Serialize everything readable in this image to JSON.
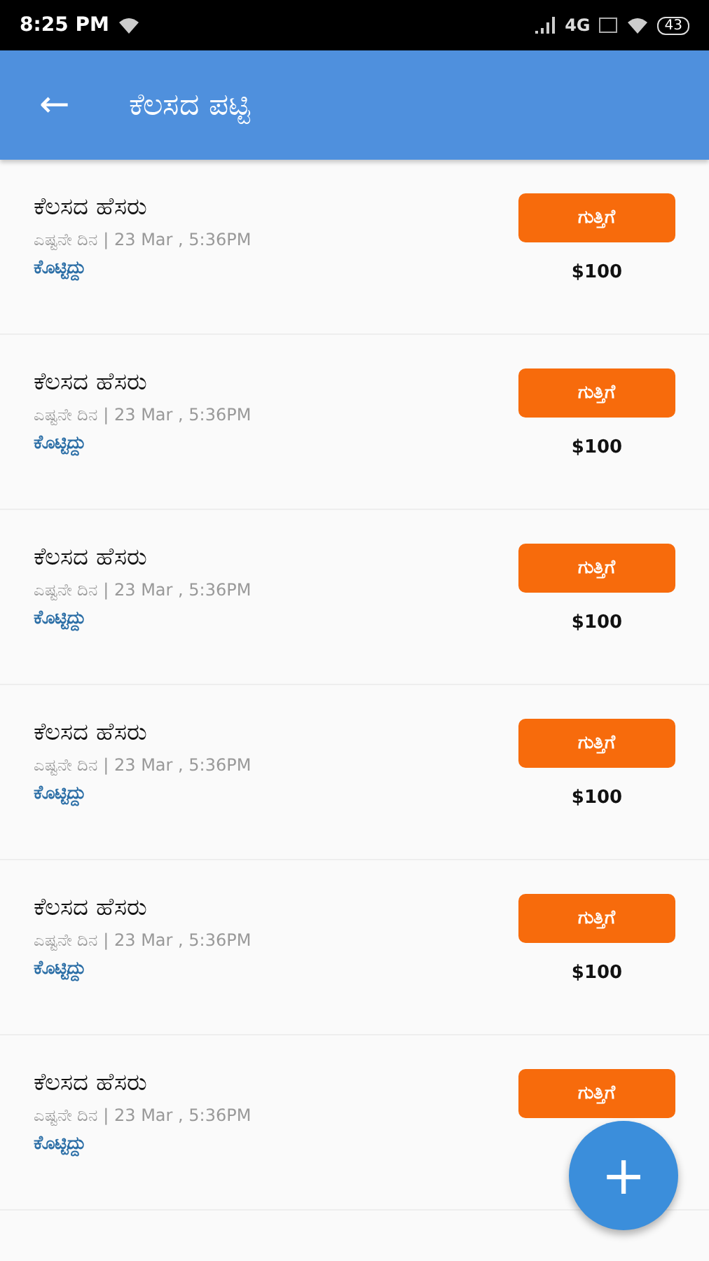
{
  "status_bar": {
    "time": "8:25 PM",
    "network": "4G",
    "battery": "43"
  },
  "app_bar": {
    "back": "←",
    "title": "ಕೆಲಸದ ಪಟ್ಟಿ"
  },
  "jobs": [
    {
      "name": "ಕೆಲಸದ ಹೆಸರು",
      "date": "ಎಷ್ಟನೇ ದಿನ | 23 Mar , 5:36PM",
      "status": "ಕೊಟ್ಟಿದ್ದು",
      "type": "ಗುತ್ತಿಗೆ",
      "price": "$100"
    },
    {
      "name": "ಕೆಲಸದ ಹೆಸರು",
      "date": "ಎಷ್ಟನೇ ದಿನ | 23 Mar , 5:36PM",
      "status": "ಕೊಟ್ಟಿದ್ದು",
      "type": "ಗುತ್ತಿಗೆ",
      "price": "$100"
    },
    {
      "name": "ಕೆಲಸದ ಹೆಸರು",
      "date": "ಎಷ್ಟನೇ ದಿನ | 23 Mar , 5:36PM",
      "status": "ಕೊಟ್ಟಿದ್ದು",
      "type": "ಗುತ್ತಿಗೆ",
      "price": "$100"
    },
    {
      "name": "ಕೆಲಸದ ಹೆಸರು",
      "date": "ಎಷ್ಟನೇ ದಿನ | 23 Mar , 5:36PM",
      "status": "ಕೊಟ್ಟಿದ್ದು",
      "type": "ಗುತ್ತಿಗೆ",
      "price": "$100"
    },
    {
      "name": "ಕೆಲಸದ ಹೆಸರು",
      "date": "ಎಷ್ಟನೇ ದಿನ | 23 Mar , 5:36PM",
      "status": "ಕೊಟ್ಟಿದ್ದು",
      "type": "ಗುತ್ತಿಗೆ",
      "price": "$100"
    },
    {
      "name": "ಕೆಲಸದ ಹೆಸರು",
      "date": "ಎಷ್ಟನೇ ದಿನ | 23 Mar , 5:36PM",
      "status": "ಕೊಟ್ಟಿದ್ದು",
      "type": "ಗುತ್ತಿಗೆ"
    }
  ],
  "fab": {
    "label": "+"
  }
}
